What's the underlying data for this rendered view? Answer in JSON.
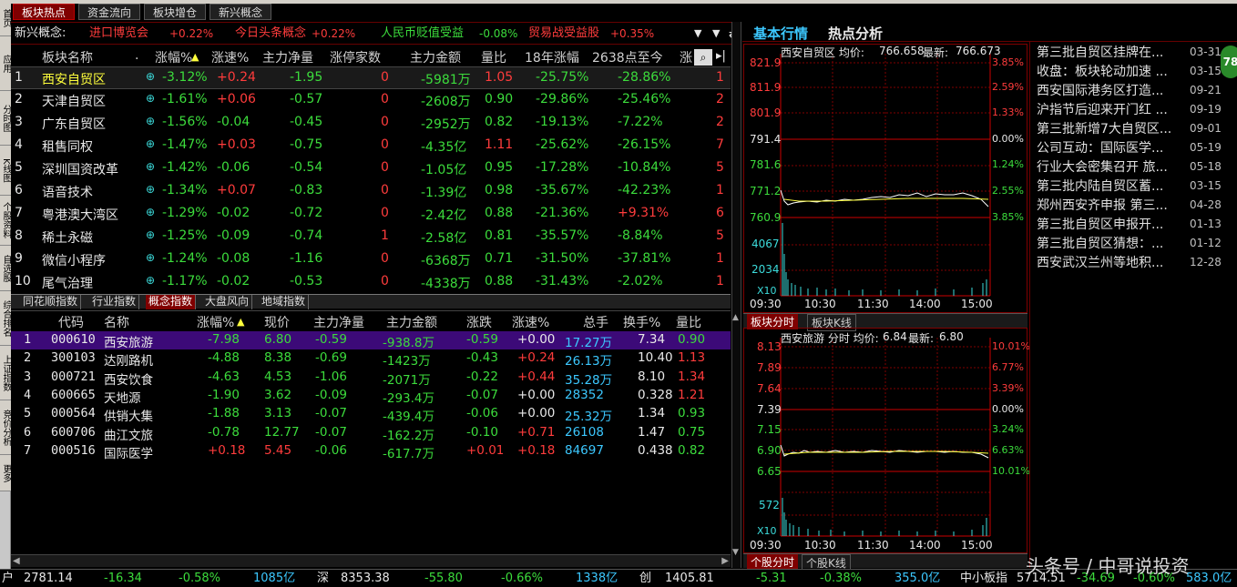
{
  "left_tabs": [
    "首页",
    "应用",
    "分时图",
    "K线图",
    "个股资料",
    "自选股",
    "综合排名",
    "上证指数",
    "竞价分析",
    "更多"
  ],
  "top_tabs": [
    "板块热点",
    "资金流向",
    "板块增仓",
    "新兴概念"
  ],
  "concept_bar": {
    "label": "新兴概念:",
    "items": [
      {
        "name": "进口博览会",
        "value": "+0.22%"
      },
      {
        "name": "今日头条概念",
        "value": "+0.22%"
      },
      {
        "name": "人民币贬值受益",
        "value": "-0.08%"
      },
      {
        "name": "贸易战受益股",
        "value": "+0.35%"
      }
    ],
    "icons": [
      "chevron-down-icon",
      "chevron-down-icon",
      "double-arrow-icon"
    ]
  },
  "board_table": {
    "columns": [
      "板块名称",
      ".",
      "涨幅%",
      "涨速%",
      "主力净量",
      "涨停家数",
      "主力金额",
      "量比",
      "18年涨幅",
      "2638点至今",
      "涨"
    ],
    "rows": [
      {
        "no": "1",
        "name": "西安自贸区",
        "chg": "-3.12%",
        "speed": "+0.24",
        "net": "-1.95",
        "limit": "0",
        "amount": "-5981万",
        "vr": "1.05",
        "y18": "-25.75%",
        "since": "-28.86%",
        "last": "1"
      },
      {
        "no": "2",
        "name": "天津自贸区",
        "chg": "-1.61%",
        "speed": "+0.06",
        "net": "-0.57",
        "limit": "0",
        "amount": "-2608万",
        "vr": "0.90",
        "y18": "-29.86%",
        "since": "-25.46%",
        "last": "2"
      },
      {
        "no": "3",
        "name": "广东自贸区",
        "chg": "-1.56%",
        "speed": "-0.04",
        "net": "-0.45",
        "limit": "0",
        "amount": "-2952万",
        "vr": "0.82",
        "y18": "-19.13%",
        "since": "-7.22%",
        "last": "2"
      },
      {
        "no": "4",
        "name": "租售同权",
        "chg": "-1.47%",
        "speed": "+0.03",
        "net": "-0.75",
        "limit": "0",
        "amount": "-4.35亿",
        "vr": "1.11",
        "y18": "-25.62%",
        "since": "-26.15%",
        "last": "7"
      },
      {
        "no": "5",
        "name": "深圳国资改革",
        "chg": "-1.42%",
        "speed": "-0.06",
        "net": "-0.54",
        "limit": "0",
        "amount": "-1.05亿",
        "vr": "0.95",
        "y18": "-17.28%",
        "since": "-10.84%",
        "last": "5"
      },
      {
        "no": "6",
        "name": "语音技术",
        "chg": "-1.34%",
        "speed": "+0.07",
        "net": "-0.83",
        "limit": "0",
        "amount": "-1.39亿",
        "vr": "0.98",
        "y18": "-35.67%",
        "since": "-42.23%",
        "last": "1"
      },
      {
        "no": "7",
        "name": "粤港澳大湾区",
        "chg": "-1.29%",
        "speed": "-0.02",
        "net": "-0.72",
        "limit": "0",
        "amount": "-2.42亿",
        "vr": "0.88",
        "y18": "-21.36%",
        "since": "+9.31%",
        "last": "6"
      },
      {
        "no": "8",
        "name": "稀土永磁",
        "chg": "-1.25%",
        "speed": "-0.09",
        "net": "-0.74",
        "limit": "1",
        "amount": "-2.58亿",
        "vr": "0.81",
        "y18": "-35.57%",
        "since": "-8.84%",
        "last": "5"
      },
      {
        "no": "9",
        "name": "微信小程序",
        "chg": "-1.24%",
        "speed": "-0.08",
        "net": "-1.16",
        "limit": "0",
        "amount": "-6368万",
        "vr": "0.71",
        "y18": "-31.50%",
        "since": "-37.81%",
        "last": "1"
      },
      {
        "no": "10",
        "name": "尾气治理",
        "chg": "-1.17%",
        "speed": "-0.02",
        "net": "-0.53",
        "limit": "0",
        "amount": "-4338万",
        "vr": "0.88",
        "y18": "-31.43%",
        "since": "-2.02%",
        "last": "1"
      }
    ]
  },
  "sub_tabs": [
    "同花顺指数",
    "行业指数",
    "概念指数",
    "大盘风向",
    "地域指数"
  ],
  "stock_table": {
    "columns": [
      "代码",
      "名称",
      "涨幅%",
      "现价",
      "主力净量",
      "主力金额",
      "涨跌",
      "涨速%",
      "总手",
      "换手%",
      "量比"
    ],
    "rows": [
      {
        "no": "1",
        "code": "000610",
        "name": "西安旅游",
        "chg": "-7.98",
        "price": "6.80",
        "net": "-0.59",
        "amount": "-938.8万",
        "diff": "-0.59",
        "speed": "+0.00",
        "vol": "17.27万",
        "turn": "7.34",
        "vr": "0.90"
      },
      {
        "no": "2",
        "code": "300103",
        "name": "达刚路机",
        "chg": "-4.88",
        "price": "8.38",
        "net": "-0.69",
        "amount": "-1423万",
        "diff": "-0.43",
        "speed": "+0.24",
        "vol": "26.13万",
        "turn": "10.40",
        "vr": "1.13"
      },
      {
        "no": "3",
        "code": "000721",
        "name": "西安饮食",
        "chg": "-4.63",
        "price": "4.53",
        "net": "-1.06",
        "amount": "-2071万",
        "diff": "-0.22",
        "speed": "+0.44",
        "vol": "35.28万",
        "turn": "8.10",
        "vr": "1.34"
      },
      {
        "no": "4",
        "code": "600665",
        "name": "天地源",
        "chg": "-1.90",
        "price": "3.62",
        "net": "-0.09",
        "amount": "-293.4万",
        "diff": "-0.07",
        "speed": "+0.00",
        "vol": "28352",
        "turn": "0.328",
        "vr": "1.21"
      },
      {
        "no": "5",
        "code": "000564",
        "name": "供销大集",
        "chg": "-1.88",
        "price": "3.13",
        "net": "-0.07",
        "amount": "-439.4万",
        "diff": "-0.06",
        "speed": "+0.00",
        "vol": "25.32万",
        "turn": "1.34",
        "vr": "0.93"
      },
      {
        "no": "6",
        "code": "600706",
        "name": "曲江文旅",
        "chg": "-0.78",
        "price": "12.77",
        "net": "-0.07",
        "amount": "-162.2万",
        "diff": "-0.10",
        "speed": "+0.71",
        "vol": "26108",
        "turn": "1.47",
        "vr": "0.75"
      },
      {
        "no": "7",
        "code": "000516",
        "name": "国际医学",
        "chg": "+0.18",
        "price": "5.45",
        "net": "-0.06",
        "amount": "-617.7万",
        "diff": "+0.01",
        "speed": "+0.18",
        "vol": "84697",
        "turn": "0.438",
        "vr": "0.82"
      }
    ]
  },
  "right_header": {
    "tab1": "基本行情",
    "tab2": "热点分析"
  },
  "chart1": {
    "title": "西安自贸区 均价:",
    "avg": "766.658",
    "latest_label": "最新:",
    "latest": "766.673",
    "price_ticks": [
      "821.9",
      "811.9",
      "801.9",
      "791.4",
      "781.6",
      "771.2",
      "760.9"
    ],
    "pct_ticks": [
      "3.85%",
      "2.59%",
      "1.33%",
      "0.00%",
      "1.24%",
      "2.55%",
      "3.85%"
    ],
    "vol_ticks": [
      "4067",
      "2034",
      "X10"
    ],
    "time_ticks": [
      "09:30",
      "10:30",
      "11:30",
      "14:00",
      "15:00"
    ],
    "tabs": [
      "板块分时",
      "板块K线"
    ]
  },
  "chart2": {
    "title": "西安旅游 分时 均价:",
    "avg": "6.84",
    "latest_label": "最新:",
    "latest": "6.80",
    "price_ticks": [
      "8.13",
      "7.89",
      "7.64",
      "7.39",
      "7.15",
      "6.90",
      "6.65"
    ],
    "pct_ticks": [
      "10.01%",
      "6.77%",
      "3.39%",
      "0.00%",
      "3.24%",
      "6.63%",
      "10.01%"
    ],
    "vol_ticks": [
      "572",
      "X10"
    ],
    "time_ticks": [
      "09:30",
      "10:30",
      "11:30",
      "14:00",
      "15:00"
    ],
    "tabs": [
      "个股分时",
      "个股K线"
    ]
  },
  "news": [
    {
      "title": "第三批自贸区挂牌在...",
      "date": "03-31"
    },
    {
      "title": "收盘：板块轮动加速 ...",
      "date": "03-15"
    },
    {
      "title": "西安国际港务区打造...",
      "date": "09-21"
    },
    {
      "title": "沪指节后迎来开门红 ...",
      "date": "09-19"
    },
    {
      "title": "第三批新增7大自贸区...",
      "date": "09-01"
    },
    {
      "title": "公司互动：国际医学...",
      "date": "05-19"
    },
    {
      "title": "行业大会密集召开 旅...",
      "date": "05-18"
    },
    {
      "title": "第三批内陆自贸区蓄...",
      "date": "03-15"
    },
    {
      "title": "郑州西安齐申报 第三...",
      "date": "04-28"
    },
    {
      "title": "第三批自贸区申报开...",
      "date": "01-13"
    },
    {
      "title": "第三批自贸区猜想：...",
      "date": "01-12"
    },
    {
      "title": "西安武汉兰州等地积...",
      "date": "12-28"
    }
  ],
  "badge": "78",
  "status_bar": {
    "sh_label": "户",
    "sh_idx": "2781.14",
    "sh_chg": "-16.34",
    "sh_pct": "-0.58%",
    "sh_amt": "1085亿",
    "sz_label": "深",
    "sz_idx": "8353.38",
    "sz_chg": "-55.80",
    "sz_pct": "-0.66%",
    "sz_amt": "1338亿",
    "cy_label": "创",
    "cy_idx": "1405.81",
    "cy_chg": "-5.31",
    "cy_pct": "-0.38%",
    "cy_amt": "355.0亿",
    "zx_label": "中小板指",
    "zx_idx": "5714.51",
    "zx_chg": "-34.69",
    "zx_pct": "-0.60%",
    "zx_amt": "583.0亿"
  },
  "watermark": "头条号 / 中哥说投资"
}
